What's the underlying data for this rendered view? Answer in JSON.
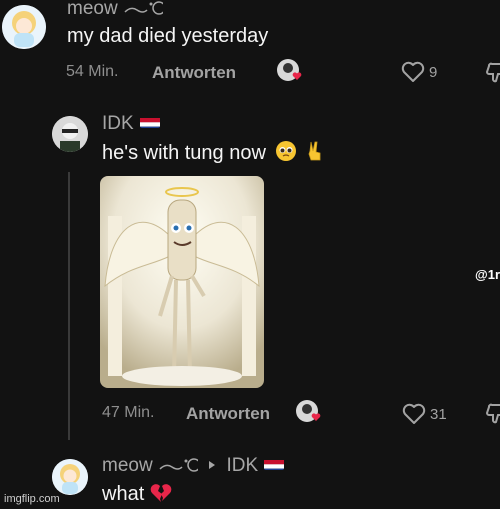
{
  "comments": [
    {
      "username": "meow",
      "text": "my dad died yesterday",
      "time": "54 Min.",
      "reply_label": "Antworten",
      "likes": "9"
    },
    {
      "username": "IDK",
      "text": "he's with tung now",
      "time": "47 Min.",
      "reply_label": "Antworten",
      "likes": "31"
    },
    {
      "username": "meow",
      "reply_to": "IDK",
      "text": "what"
    }
  ],
  "overlay_handle": "@1r",
  "watermark": "imgflip.com",
  "icons": {
    "heart": "heart-outline-icon",
    "dislike": "thumbs-down-icon",
    "flag": "netherlands-flag-icon"
  },
  "colors": {
    "background": "#121212",
    "heart_red": "#e8264a"
  }
}
